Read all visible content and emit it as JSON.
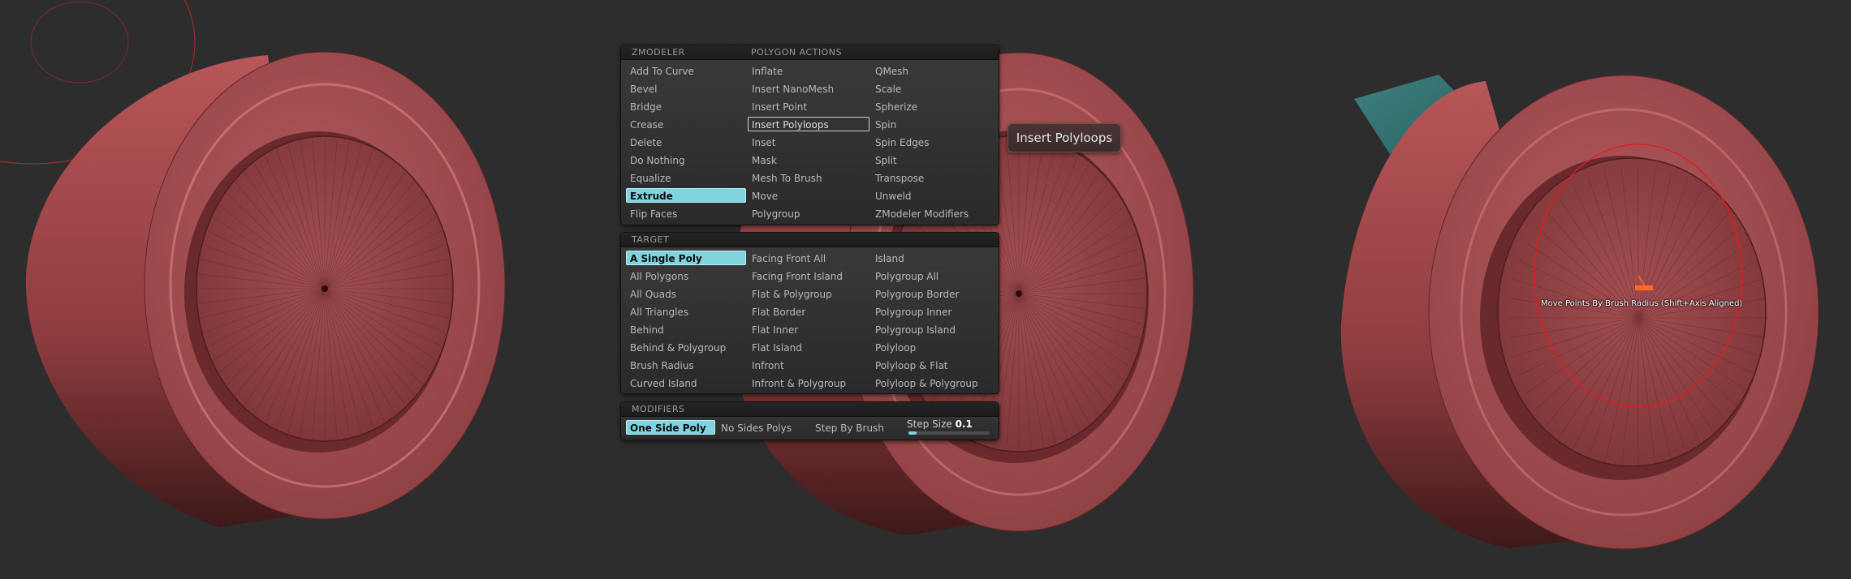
{
  "zmodeler_panel": {
    "section1_title": "ZMODELER",
    "section1_subtitle": "POLYGON ACTIONS",
    "actions": [
      [
        "Add To Curve",
        "Inflate",
        "QMesh"
      ],
      [
        "Bevel",
        "Insert NanoMesh",
        "Scale"
      ],
      [
        "Bridge",
        "Insert Point",
        "Spherize"
      ],
      [
        "Crease",
        "Insert Polyloops",
        "Spin"
      ],
      [
        "Delete",
        "Inset",
        "Spin Edges"
      ],
      [
        "Do Nothing",
        "Mask",
        "Split"
      ],
      [
        "Equalize",
        "Mesh To Brush",
        "Transpose"
      ],
      [
        "Extrude",
        "Move",
        "Unweld"
      ],
      [
        "Flip Faces",
        "Polygroup",
        "ZModeler Modifiers"
      ]
    ],
    "active_action": "Extrude",
    "hovered_action": "Insert Polyloops",
    "section2_title": "TARGET",
    "targets": [
      [
        "A Single Poly",
        "Facing Front All",
        "Island"
      ],
      [
        "All Polygons",
        "Facing Front Island",
        "Polygroup All"
      ],
      [
        "All Quads",
        "Flat & Polygroup",
        "Polygroup Border"
      ],
      [
        "All Triangles",
        "Flat Border",
        "Polygroup Inner"
      ],
      [
        "Behind",
        "Flat Inner",
        "Polygroup Island"
      ],
      [
        "Behind & Polygroup",
        "Flat Island",
        "Polyloop"
      ],
      [
        "Brush Radius",
        "Infront",
        "Polyloop & Flat"
      ],
      [
        "Curved Island",
        "Infront & Polygroup",
        "Polyloop & Polygroup"
      ]
    ],
    "active_target": "A Single Poly",
    "section3_title": "MODIFIERS",
    "modifiers": [
      "One Side Poly",
      "No Sides Polys",
      "Step By Brush"
    ],
    "active_modifier": "One Side Poly",
    "step_size_label": "Step Size",
    "step_size_value": "0.1",
    "step_size_fraction": 0.1
  },
  "tooltip": {
    "text": "Insert Polyloops"
  },
  "viewport_right": {
    "brush_label": "Move Points By Brush Radius (Shift+Axis Aligned)"
  },
  "colors": {
    "background": "#2d2d2d",
    "mesh": "#a44d50",
    "mesh_light": "#c9686a",
    "mesh_dark": "#5e2628",
    "accent": "#7fd4e0",
    "teal_box": "#2f6a6a",
    "brush_circle": "#e01e1e"
  }
}
